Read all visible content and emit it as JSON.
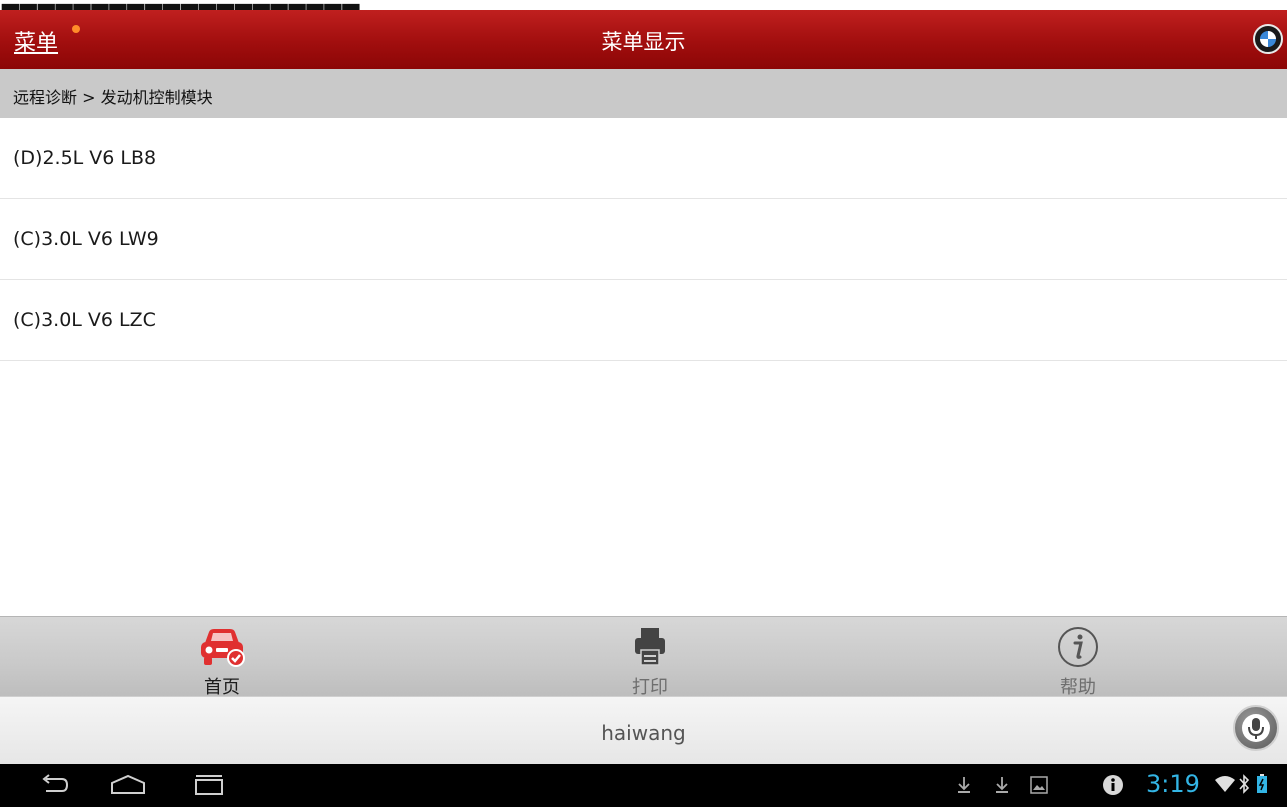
{
  "header": {
    "menu_label": "菜单",
    "title": "菜单显示",
    "logo_icon": "bmw-logo-icon"
  },
  "breadcrumb": {
    "path": "远程诊断 > 发动机控制模块"
  },
  "engine_list": {
    "items": [
      {
        "label": "(D)2.5L V6 LB8"
      },
      {
        "label": "(C)3.0L V6 LW9"
      },
      {
        "label": "(C)3.0L V6 LZC"
      }
    ]
  },
  "toolbar": {
    "home_label": "首页",
    "print_label": "打印",
    "help_label": "帮助"
  },
  "search": {
    "text": "haiwang"
  },
  "status_bar": {
    "time": "3:19"
  },
  "colors": {
    "header_red": "#a10e0e",
    "home_icon_red": "#e03030",
    "clock_blue": "#33b5e5",
    "notification_dot": "#ff8c2a"
  }
}
